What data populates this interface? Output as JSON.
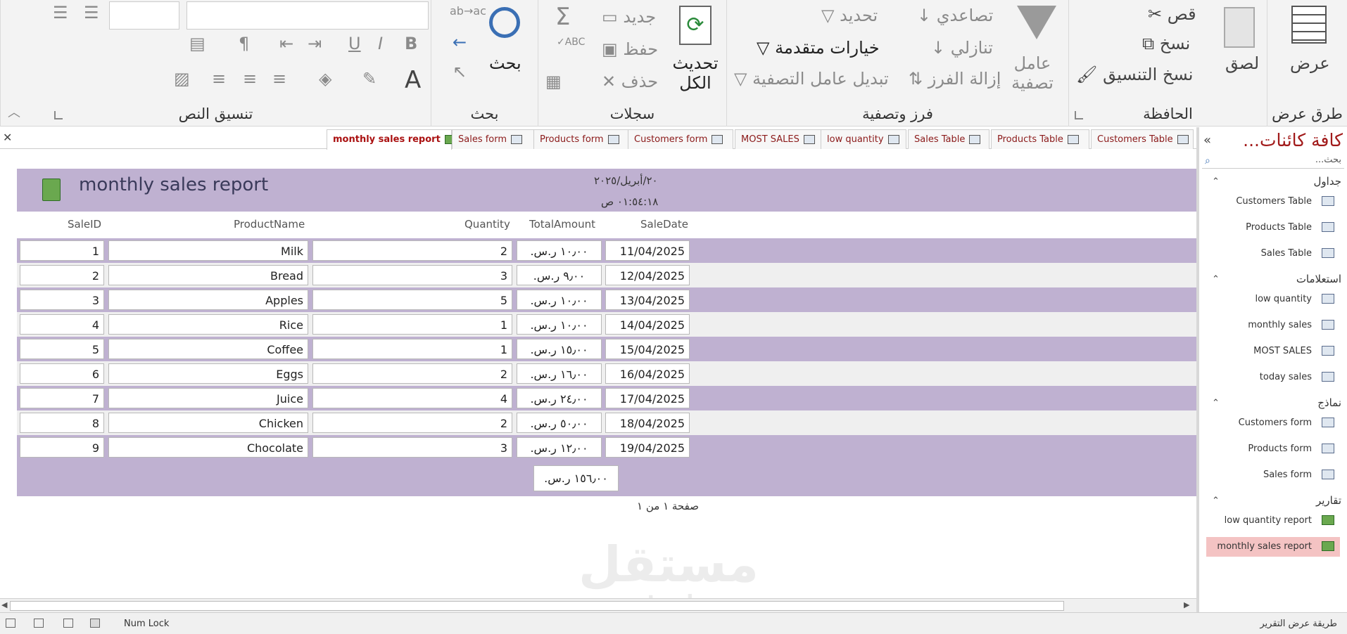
{
  "ribbon": {
    "views": {
      "group_label": "طرق عرض",
      "view_label": "عرض"
    },
    "clipboard": {
      "group_label": "الحافظة",
      "paste": "لصق",
      "cut": "قص",
      "copy": "نسخ",
      "format_painter": "نسخ التنسيق"
    },
    "sort_filter": {
      "group_label": "فرز وتصفية",
      "filter": "عامل تصفية",
      "ascending": "تصاعدي",
      "descending": "تنازلي",
      "remove_sort": "إزالة الفرز",
      "selection": "تحديد",
      "advanced": "خيارات متقدمة",
      "toggle_filter": "تبديل عامل التصفية"
    },
    "records": {
      "group_label": "سجلات",
      "refresh_all": "تحديث الكل",
      "new": "جديد",
      "save": "حفظ",
      "delete": "حذف"
    },
    "find": {
      "group_label": "بحث",
      "find": "بحث"
    },
    "text_formatting": {
      "group_label": "تنسيق النص"
    }
  },
  "doc_tabs": [
    {
      "label": "monthly sales report",
      "active": true,
      "icon": "report-icon"
    },
    {
      "label": "Sales form",
      "active": false,
      "icon": "form-icon"
    },
    {
      "label": "Products form",
      "active": false,
      "icon": "form-icon"
    },
    {
      "label": "Customers form",
      "active": false,
      "icon": "form-icon"
    },
    {
      "label": "MOST SALES",
      "active": false,
      "icon": "query-icon"
    },
    {
      "label": "low quantity",
      "active": false,
      "icon": "query-icon"
    },
    {
      "label": "Sales Table",
      "active": false,
      "icon": "table-icon"
    },
    {
      "label": "Products Table",
      "active": false,
      "icon": "table-icon"
    },
    {
      "label": "Customers Table",
      "active": false,
      "icon": "table-icon"
    }
  ],
  "report": {
    "title": "monthly sales report",
    "date": "٢٠/أبريل/٢٠٢٥",
    "time": "٠١:٥٤:١٨ ص",
    "columns": [
      "SaleID",
      "ProductName",
      "Quantity",
      "TotalAmount",
      "SaleDate"
    ],
    "rows": [
      [
        "1",
        "Milk",
        "2",
        "١٠٫٠٠ ر.س.",
        "11/04/2025"
      ],
      [
        "2",
        "Bread",
        "3",
        "٩٫٠٠ ر.س.",
        "12/04/2025"
      ],
      [
        "3",
        "Apples",
        "5",
        "١٠٫٠٠ ر.س.",
        "13/04/2025"
      ],
      [
        "4",
        "Rice",
        "1",
        "١٠٫٠٠ ر.س.",
        "14/04/2025"
      ],
      [
        "5",
        "Coffee",
        "1",
        "١٥٫٠٠ ر.س.",
        "15/04/2025"
      ],
      [
        "6",
        "Eggs",
        "2",
        "١٦٫٠٠ ر.س.",
        "16/04/2025"
      ],
      [
        "7",
        "Juice",
        "4",
        "٢٤٫٠٠ ر.س.",
        "17/04/2025"
      ],
      [
        "8",
        "Chicken",
        "2",
        "٥٠٫٠٠ ر.س.",
        "18/04/2025"
      ],
      [
        "9",
        "Chocolate",
        "3",
        "١٢٫٠٠ ر.س.",
        "19/04/2025"
      ]
    ],
    "total": "١٥٦٫٠٠ ر.س.",
    "page_label": "صفحة ١ من ١"
  },
  "watermark": {
    "line1": "مستقل",
    "line2": "mostaql.com"
  },
  "nav": {
    "title": "كافة كائنات...",
    "search_placeholder": "بحث...",
    "categories": [
      {
        "label": "جداول",
        "items": [
          {
            "label": "Customers Table",
            "icon": "table-icon"
          },
          {
            "label": "Products Table",
            "icon": "table-icon"
          },
          {
            "label": "Sales Table",
            "icon": "table-icon"
          }
        ]
      },
      {
        "label": "استعلامات",
        "items": [
          {
            "label": "low quantity",
            "icon": "query-icon"
          },
          {
            "label": "monthly sales",
            "icon": "query-icon"
          },
          {
            "label": "MOST SALES",
            "icon": "query-icon"
          },
          {
            "label": "today sales",
            "icon": "query-icon"
          }
        ]
      },
      {
        "label": "نماذج",
        "items": [
          {
            "label": "Customers form",
            "icon": "form-icon"
          },
          {
            "label": "Products form",
            "icon": "form-icon"
          },
          {
            "label": "Sales form",
            "icon": "form-icon"
          }
        ]
      },
      {
        "label": "تقارير",
        "items": [
          {
            "label": "low quantity report",
            "icon": "report-icon"
          },
          {
            "label": "monthly sales report",
            "icon": "report-icon",
            "selected": true
          }
        ]
      }
    ]
  },
  "status": {
    "mode": "طريقة عرض التقرير",
    "numlock": "Num Lock"
  },
  "colors": {
    "band": "#bfb1d1",
    "accent": "#a11a1a",
    "selected": "#f4c3c3"
  }
}
